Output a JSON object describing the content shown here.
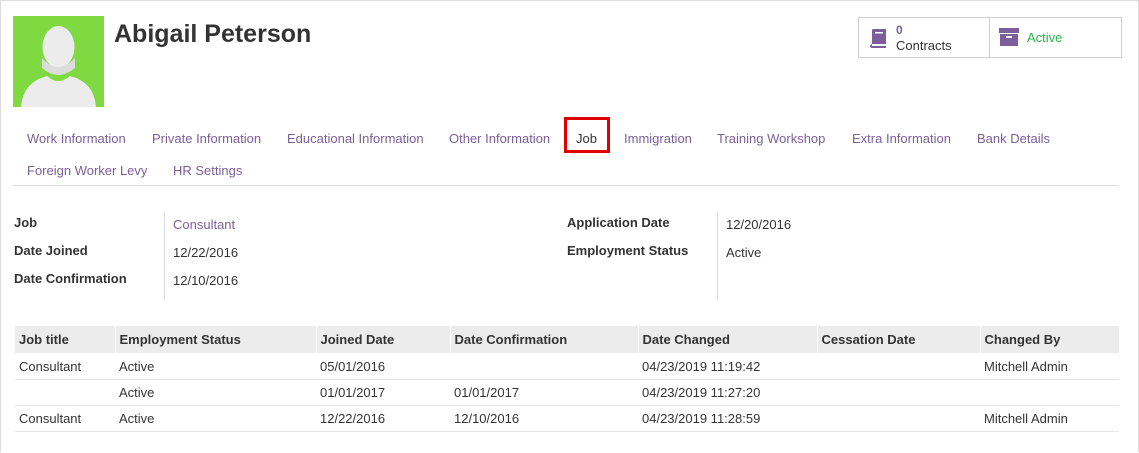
{
  "employee": {
    "name": "Abigail Peterson"
  },
  "stats": {
    "contracts_count": "0",
    "contracts_label": "Contracts",
    "active_label": "Active"
  },
  "colors": {
    "accent": "#7c5e9b",
    "active_green": "#2bb24c",
    "avatar_bg": "#7fd940",
    "highlight_red": "#e00000"
  },
  "tabs": [
    {
      "label": "Work Information"
    },
    {
      "label": "Private Information"
    },
    {
      "label": "Educational Information"
    },
    {
      "label": "Other Information"
    },
    {
      "label": "Job",
      "active": true
    },
    {
      "label": "Immigration"
    },
    {
      "label": "Training Workshop"
    },
    {
      "label": "Extra Information"
    },
    {
      "label": "Bank Details"
    },
    {
      "label": "Foreign Worker Levy"
    },
    {
      "label": "HR Settings"
    }
  ],
  "fields": {
    "job_label": "Job",
    "job_value": "Consultant",
    "date_joined_label": "Date Joined",
    "date_joined_value": "12/22/2016",
    "date_confirmation_label": "Date Confirmation",
    "date_confirmation_value": "12/10/2016",
    "application_date_label": "Application Date",
    "application_date_value": "12/20/2016",
    "employment_status_label": "Employment Status",
    "employment_status_value": "Active"
  },
  "history": {
    "columns": [
      "Job title",
      "Employment Status",
      "Joined Date",
      "Date Confirmation",
      "Date Changed",
      "Cessation Date",
      "Changed By"
    ],
    "rows": [
      [
        "Consultant",
        "Active",
        "05/01/2016",
        "",
        "04/23/2019 11:19:42",
        "",
        "Mitchell Admin"
      ],
      [
        "",
        "Active",
        "01/01/2017",
        "01/01/2017",
        "04/23/2019 11:27:20",
        "",
        ""
      ],
      [
        "Consultant",
        "Active",
        "12/22/2016",
        "12/10/2016",
        "04/23/2019 11:28:59",
        "",
        "Mitchell Admin"
      ]
    ]
  }
}
